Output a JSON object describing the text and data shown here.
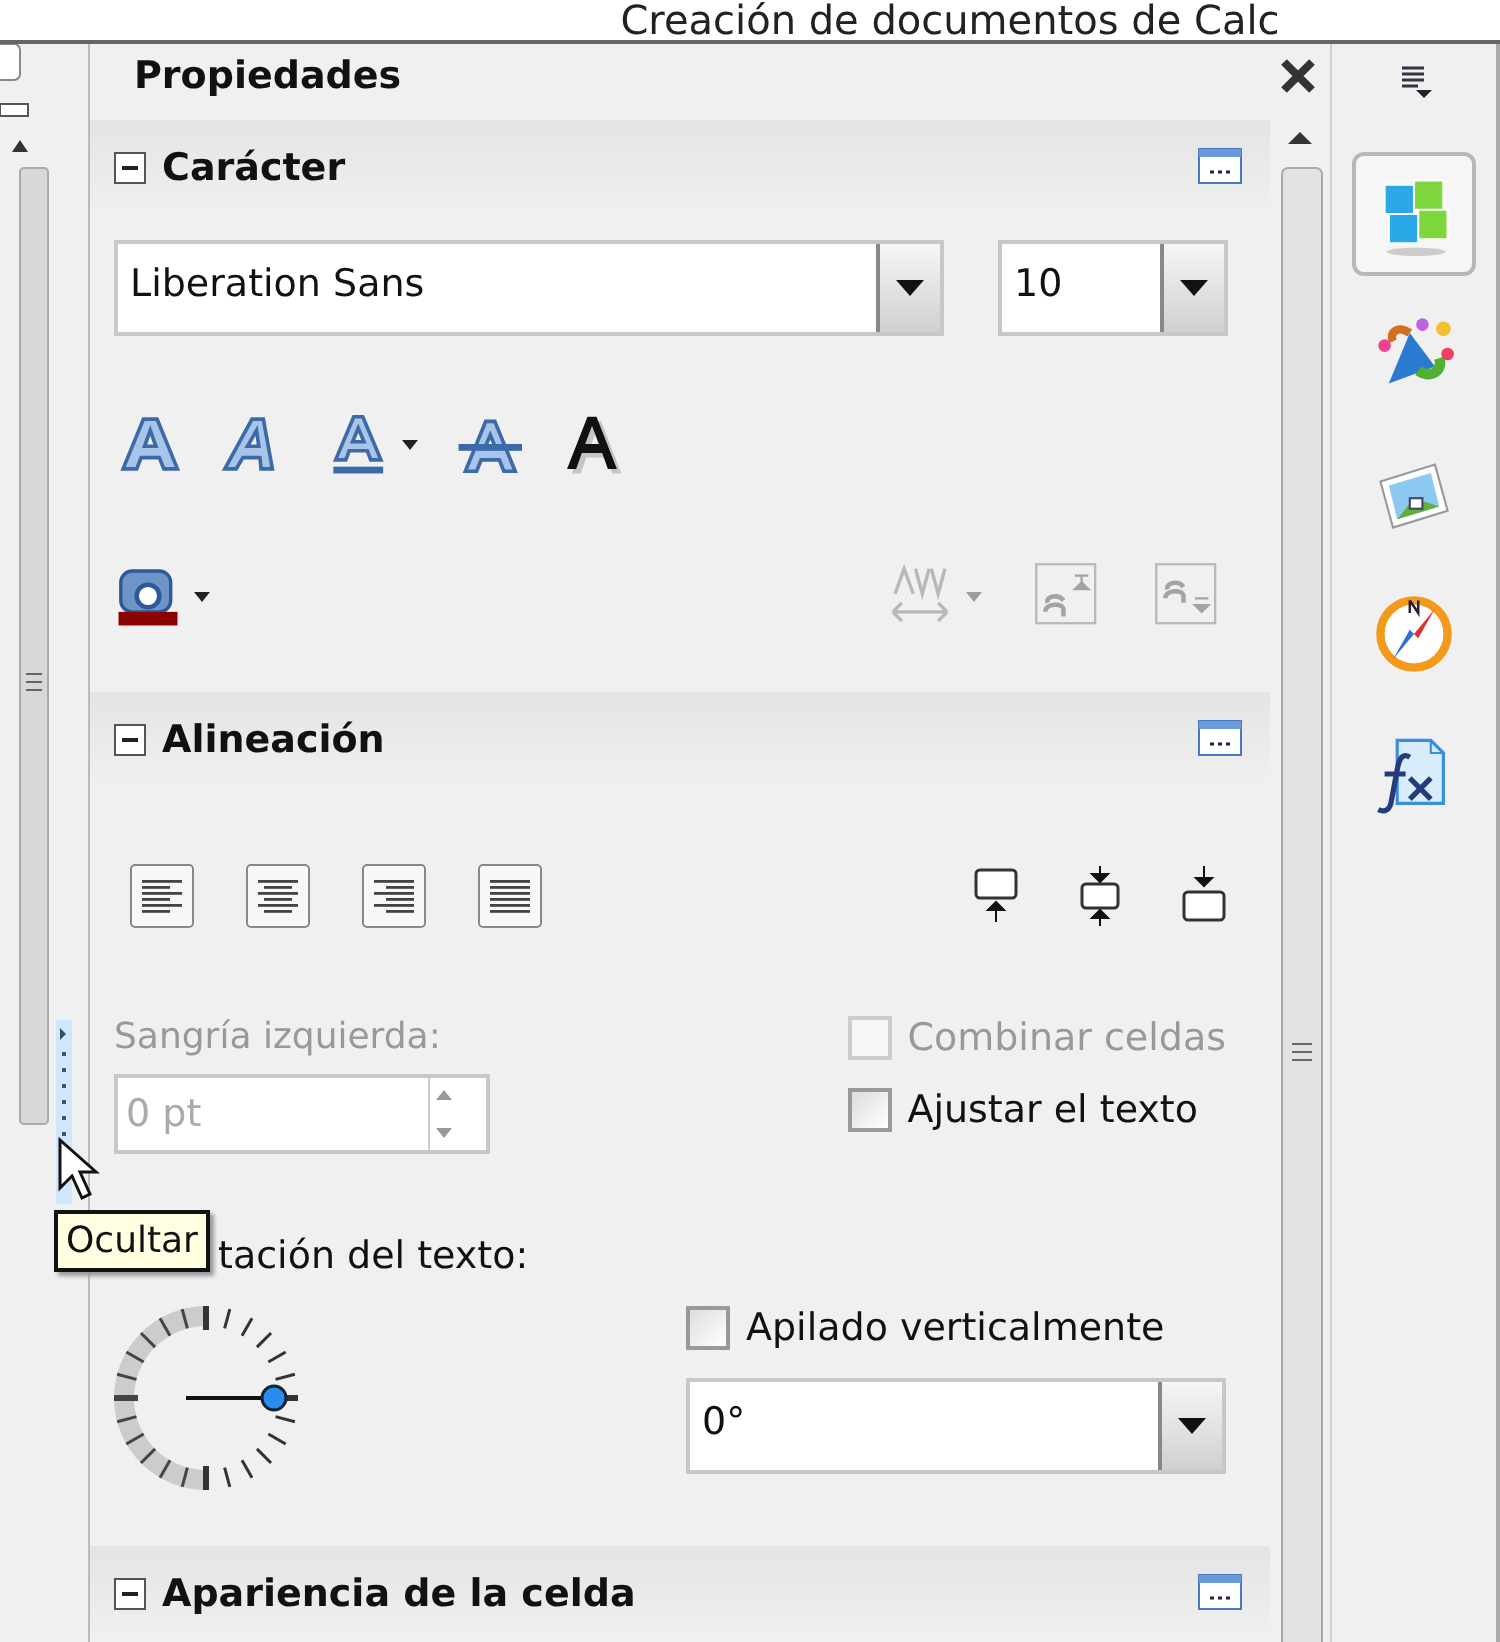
{
  "caption": "Creación de documentos de Calc",
  "sidebar": {
    "title": "Propiedades",
    "sections": [
      {
        "kind": "character",
        "title": "Carácter",
        "expanded": true,
        "font_name": "Liberation Sans",
        "font_size": "10",
        "format_tools": [
          {
            "kind": "bold",
            "disabled": false
          },
          {
            "kind": "italic",
            "disabled": false
          },
          {
            "kind": "underline",
            "disabled": false
          },
          {
            "kind": "strikethrough",
            "disabled": false
          },
          {
            "kind": "shadow",
            "disabled": false
          }
        ],
        "extra_tools": [
          {
            "kind": "font-color",
            "disabled": false
          },
          {
            "kind": "spacing",
            "disabled": true
          },
          {
            "kind": "superscript",
            "disabled": true
          },
          {
            "kind": "subscript",
            "disabled": true
          }
        ]
      },
      {
        "kind": "alignment",
        "title": "Alineación",
        "expanded": true,
        "indent_label": "Sangría izquierda:",
        "indent_value": "0 pt",
        "indent_disabled": true,
        "checkboxes": [
          {
            "label": "Combinar celdas",
            "checked": false,
            "disabled": true
          },
          {
            "label": "Ajustar el texto",
            "checked": false,
            "disabled": false
          }
        ],
        "orientation_label": "tación del texto:",
        "stacked": {
          "label": "Apilado verticalmente",
          "checked": false
        },
        "angle": "0°"
      },
      {
        "kind": "cell_appearance",
        "title": "Apariencia de la celda",
        "expanded": true
      }
    ]
  },
  "tooltip": "Ocultar",
  "tabs": [
    {
      "kind": "properties",
      "selected": true
    },
    {
      "kind": "styles",
      "selected": false
    },
    {
      "kind": "gallery",
      "selected": false
    },
    {
      "kind": "navigator",
      "selected": false
    },
    {
      "kind": "functions",
      "selected": false
    }
  ]
}
